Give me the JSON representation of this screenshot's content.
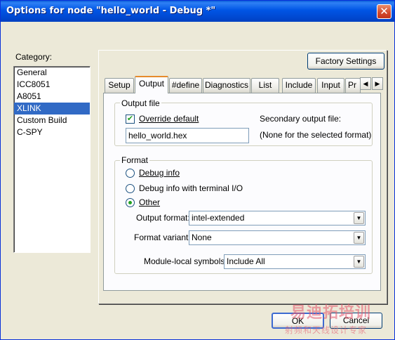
{
  "window": {
    "title": "Options for node \"hello_world - Debug *\"",
    "close_glyph": "✕"
  },
  "category": {
    "label": "Category:",
    "items": [
      "General",
      "ICC8051",
      "A8051",
      "XLINK",
      "Custom Build",
      "C-SPY"
    ],
    "selected": "XLINK"
  },
  "factory_settings_label": "Factory Settings",
  "tabs": [
    "Setup",
    "Output",
    "#define",
    "Diagnostics",
    "List",
    "Include",
    "Input",
    "Pr"
  ],
  "active_tab": "Output",
  "output_file": {
    "group_title": "Output file",
    "override_label": "Override default",
    "override_checked": true,
    "filename_value": "hello_world.hex",
    "secondary_label": "Secondary output file:",
    "secondary_value": "(None for the selected format)"
  },
  "format": {
    "group_title": "Format",
    "options": [
      "Debug info",
      "Debug info with terminal I/O",
      "Other"
    ],
    "selected_option": "Other",
    "output_format_label": "Output format:",
    "output_format_value": "intel-extended",
    "format_variant_label": "Format variant:",
    "format_variant_value": "None",
    "module_local_label": "Module-local symbols:",
    "module_local_value": "Include All"
  },
  "buttons": {
    "ok": "OK",
    "cancel": "Cancel"
  },
  "watermark": {
    "line1": "易迪拓培训",
    "line2": "射频和天线设计专家"
  },
  "colors": {
    "title_bar": "#0055e5",
    "selection": "#316ac5",
    "active_tab_accent": "#e68b2c",
    "dialog_bg": "#ece9d8"
  }
}
